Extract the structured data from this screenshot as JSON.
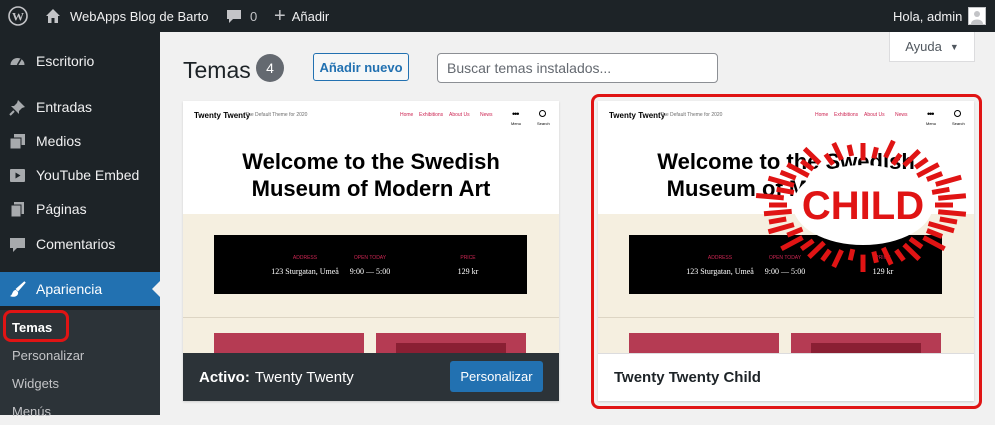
{
  "topbar": {
    "site_name": "WebApps Blog de Barto",
    "comments_count": "0",
    "new_label": "Añadir",
    "greeting": "Hola, admin"
  },
  "sidebar": {
    "items": [
      {
        "label": "Escritorio",
        "icon": "dashboard-icon"
      },
      {
        "label": "Entradas",
        "icon": "pin-icon"
      },
      {
        "label": "Medios",
        "icon": "media-icon"
      },
      {
        "label": "YouTube Embed",
        "icon": "youtube-icon"
      },
      {
        "label": "Páginas",
        "icon": "pages-icon"
      },
      {
        "label": "Comentarios",
        "icon": "comments-icon"
      },
      {
        "label": "Apariencia",
        "icon": "brush-icon"
      }
    ],
    "submenu": [
      "Temas",
      "Personalizar",
      "Widgets",
      "Menús"
    ]
  },
  "main": {
    "title": "Temas",
    "count": "4",
    "add_new_label": "Añadir nuevo",
    "search_placeholder": "Buscar temas instalados...",
    "help_label": "Ayuda"
  },
  "preview": {
    "site_title": "Twenty Twenty",
    "tagline": "The Default Theme for 2020",
    "nav": [
      "Home",
      "Exhibitions",
      "About Us",
      "News"
    ],
    "menu_label": "Menu",
    "search_label": "Search",
    "headline_1": "Welcome to the Swedish",
    "headline_2": "Museum of Modern Art",
    "info": [
      {
        "label": "ADDRESS",
        "value": "123 Sturgatan, Umeå"
      },
      {
        "label": "OPEN TODAY",
        "value": "9:00 — 5:00"
      },
      {
        "label": "PRICE",
        "value": "129 kr"
      }
    ]
  },
  "themes": [
    {
      "active_prefix": "Activo:",
      "name": "Twenty Twenty",
      "button": "Personalizar"
    },
    {
      "name": "Twenty Twenty Child",
      "badge": "CHILD"
    }
  ],
  "colors": {
    "admin_bar": "#1d2327",
    "accent": "#2271b1",
    "highlight": "#e01414"
  }
}
